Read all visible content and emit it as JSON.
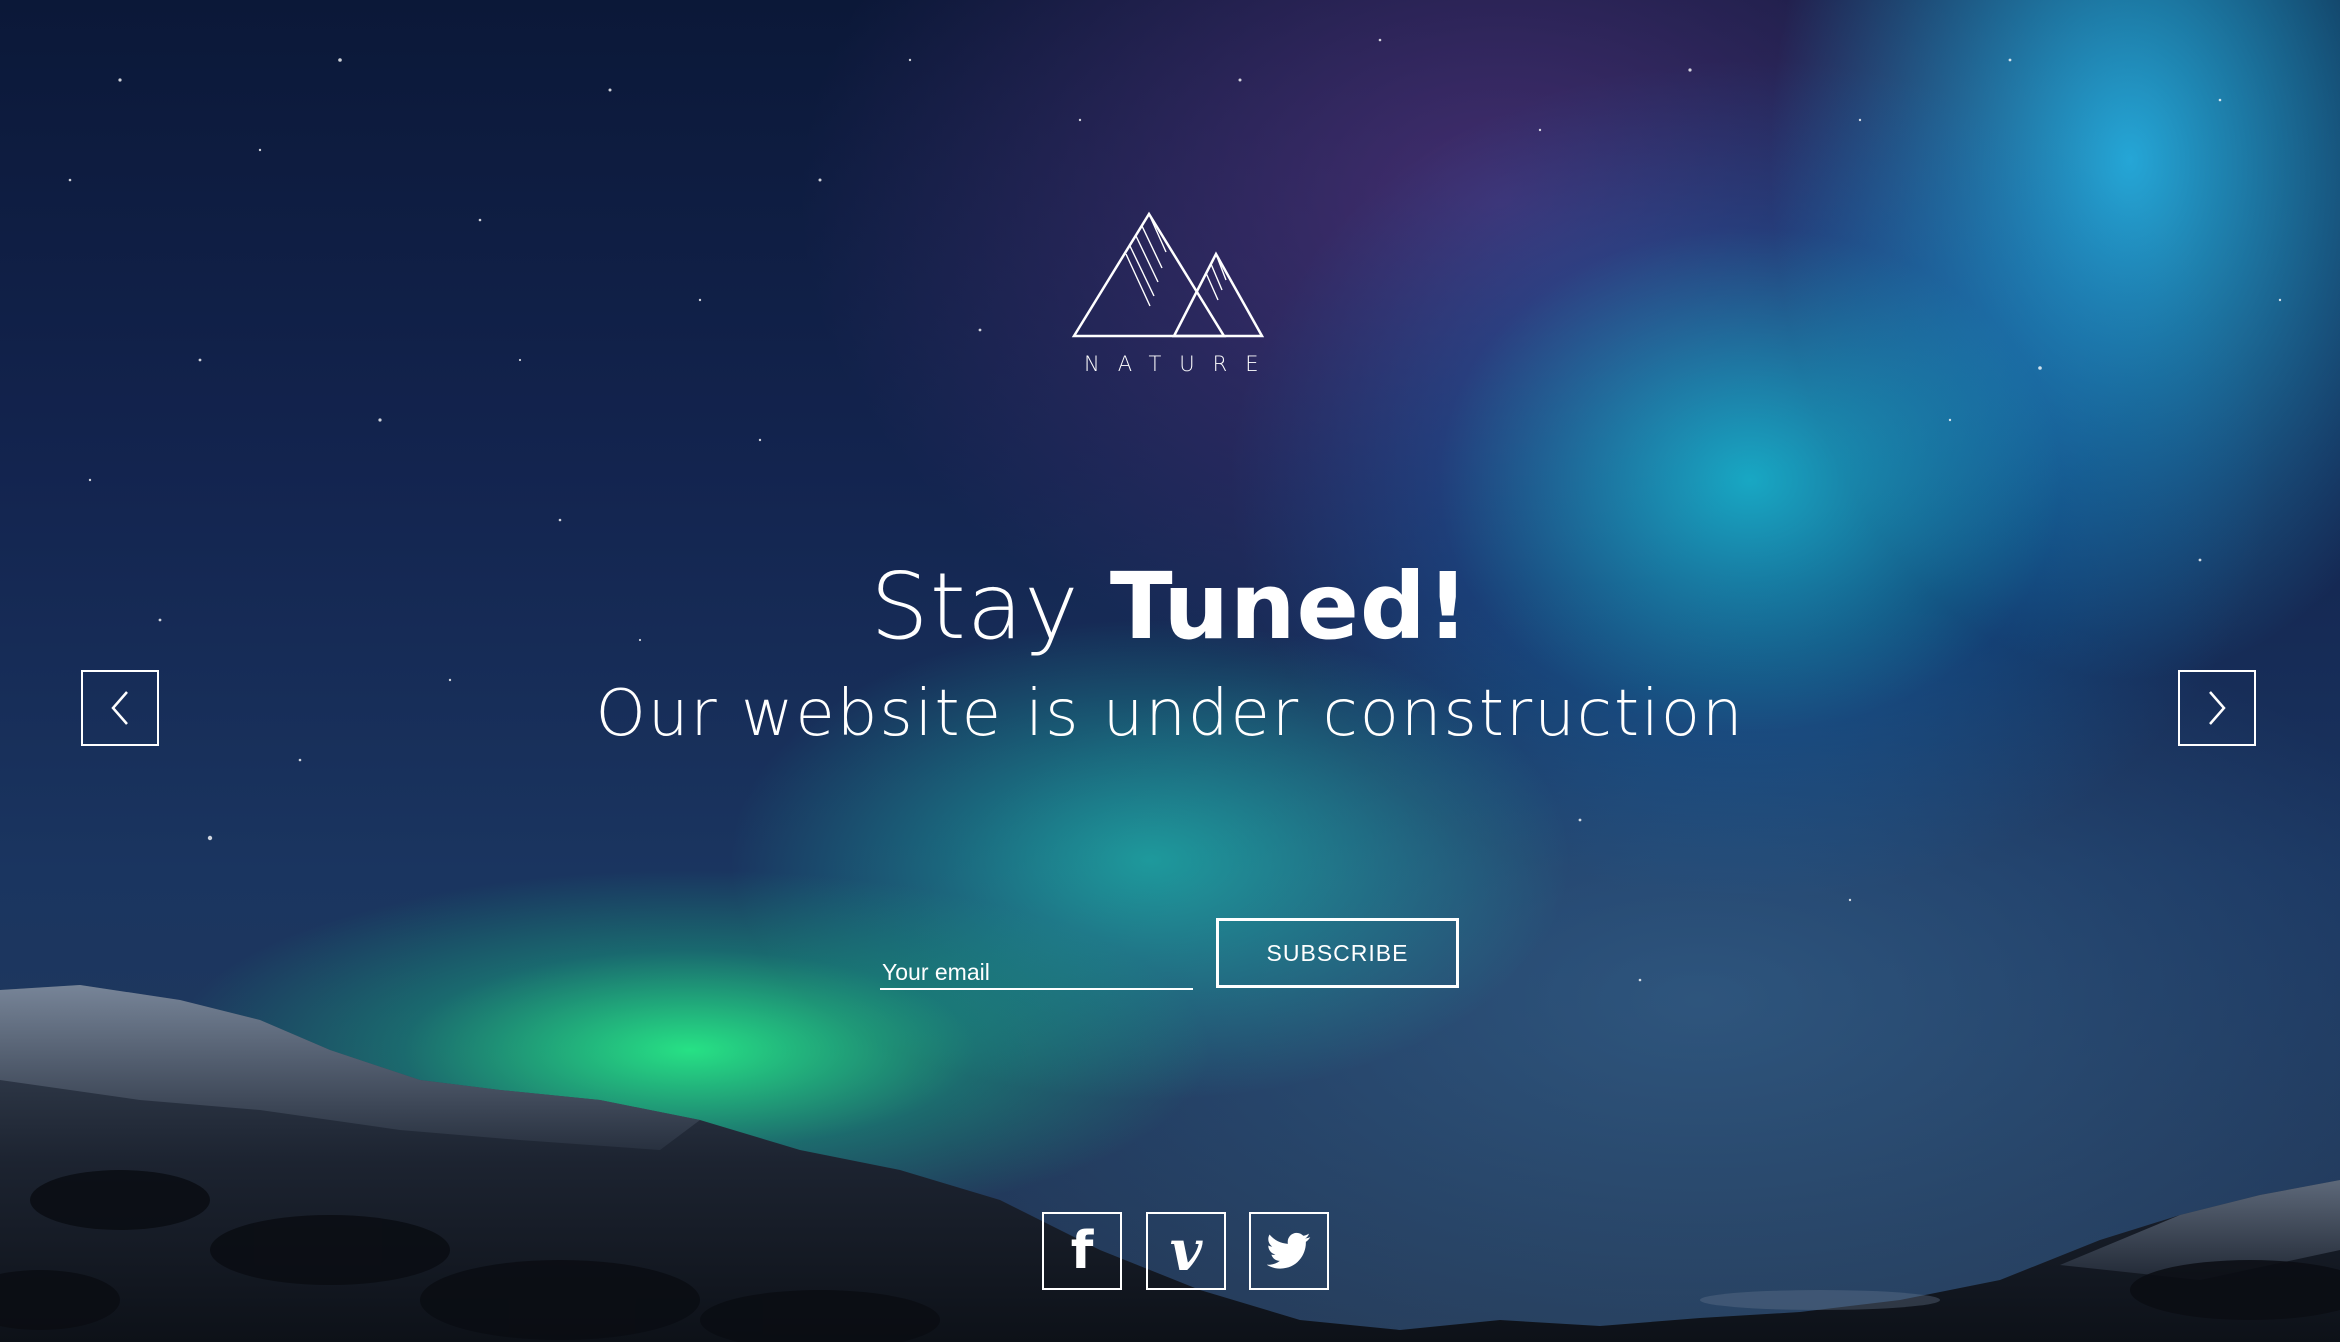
{
  "brand": {
    "name": "NATURE",
    "logo_icon": "mountains-logo-icon"
  },
  "hero": {
    "title_light": "Stay",
    "title_bold": "Tuned!",
    "subtitle": "Our website is under construction"
  },
  "slider": {
    "prev_icon": "chevron-left-icon",
    "next_icon": "chevron-right-icon"
  },
  "subscribe": {
    "email_placeholder": "Your email",
    "email_value": "",
    "button_label": "SUBSCRIBE"
  },
  "social": [
    {
      "network": "facebook",
      "icon": "facebook-icon",
      "glyph": "f"
    },
    {
      "network": "vimeo",
      "icon": "vimeo-icon",
      "glyph": "v"
    },
    {
      "network": "twitter",
      "icon": "twitter-icon"
    }
  ],
  "colors": {
    "foreground": "#ffffff",
    "sky_dark": "#0b1838",
    "aurora_green": "#28ff8c",
    "aurora_cyan": "#14d2e6"
  }
}
